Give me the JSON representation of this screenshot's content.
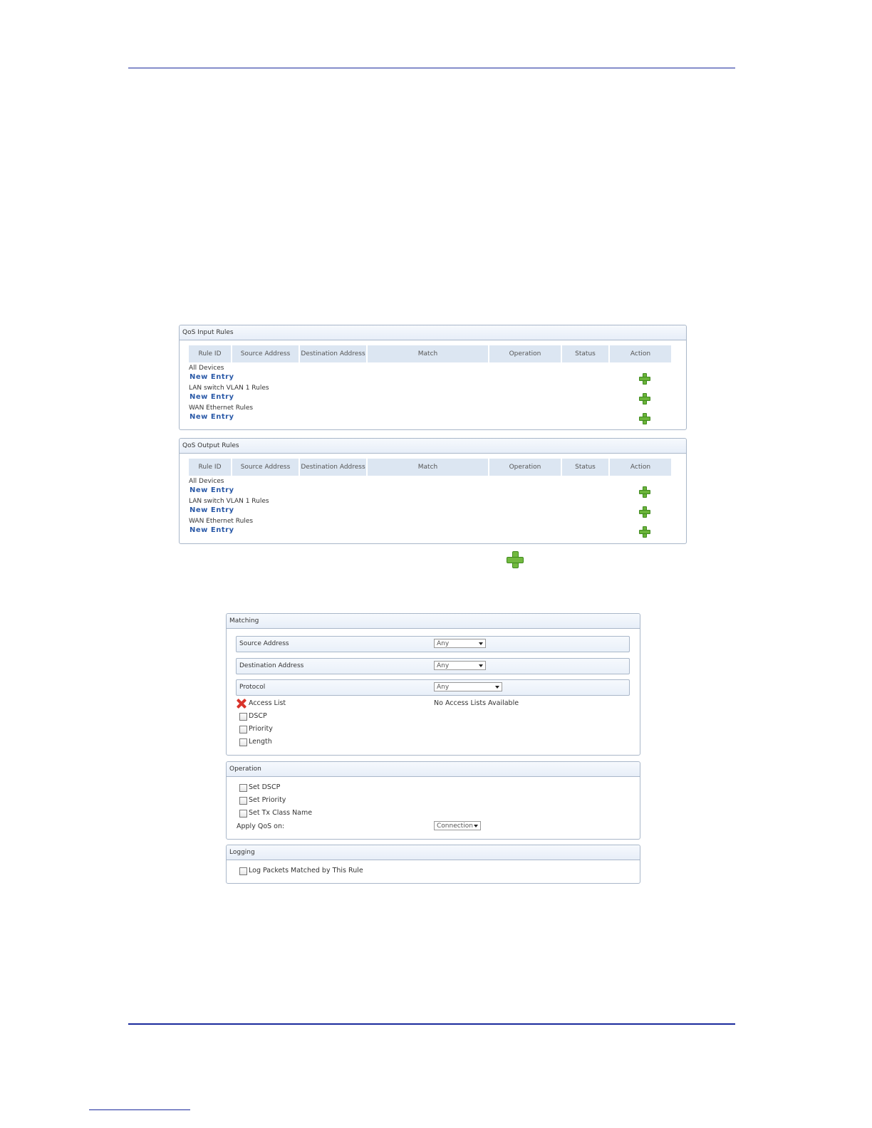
{
  "input_rules": {
    "title": "QoS Input Rules",
    "columns": [
      "Rule ID",
      "Source Address",
      "Destination Address",
      "Match",
      "Operation",
      "Status",
      "Action"
    ],
    "groups": [
      {
        "label": "All Devices",
        "new_entry": "New Entry"
      },
      {
        "label": "LAN switch VLAN 1 Rules",
        "new_entry": "New Entry"
      },
      {
        "label": "WAN Ethernet Rules",
        "new_entry": "New Entry"
      }
    ]
  },
  "output_rules": {
    "title": "QoS Output Rules",
    "columns": [
      "Rule ID",
      "Source Address",
      "Destination Address",
      "Match",
      "Operation",
      "Status",
      "Action"
    ],
    "groups": [
      {
        "label": "All Devices",
        "new_entry": "New Entry"
      },
      {
        "label": "LAN switch VLAN 1 Rules",
        "new_entry": "New Entry"
      },
      {
        "label": "WAN Ethernet Rules",
        "new_entry": "New Entry"
      }
    ]
  },
  "matching": {
    "title": "Matching",
    "source_address": {
      "label": "Source Address",
      "value": "Any"
    },
    "destination_address": {
      "label": "Destination Address",
      "value": "Any"
    },
    "protocol": {
      "label": "Protocol",
      "value": "Any"
    },
    "access_list": {
      "label": "Access List",
      "value": "No Access Lists Available"
    },
    "dscp": {
      "label": "DSCP"
    },
    "priority": {
      "label": "Priority"
    },
    "length": {
      "label": "Length"
    }
  },
  "operation": {
    "title": "Operation",
    "set_dscp": {
      "label": "Set DSCP"
    },
    "set_priority": {
      "label": "Set Priority"
    },
    "set_tx_class": {
      "label": "Set Tx Class Name"
    },
    "apply_qos": {
      "label": "Apply QoS on:",
      "value": "Connection"
    }
  },
  "logging": {
    "title": "Logging",
    "log_packets": {
      "label": "Log Packets Matched by This Rule"
    }
  },
  "colors": {
    "accent_line": "#1a2a9c",
    "link": "#2b5aa8",
    "plus_green": "#6bb43a",
    "header_bg": "#dce6f2"
  }
}
